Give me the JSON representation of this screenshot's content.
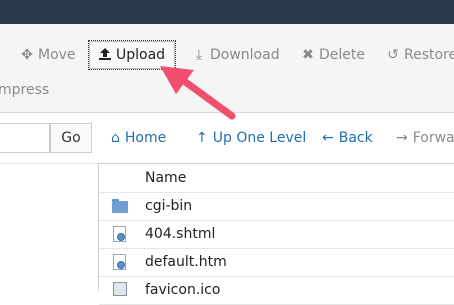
{
  "toolbar": {
    "move_label": "Move",
    "upload_label": "Upload",
    "download_label": "Download",
    "delete_label": "Delete",
    "restore_label": "Restore",
    "compress_label": "mpress"
  },
  "pathbar": {
    "go_label": "Go",
    "home_label": "Home",
    "up_label": "Up One Level",
    "back_label": "Back",
    "forward_label": "Forwar"
  },
  "filelist": {
    "header_name": "Name",
    "files": [
      {
        "name": "cgi-bin",
        "icon": "folder-icon"
      },
      {
        "name": "404.shtml",
        "icon": "html-file-icon"
      },
      {
        "name": "default.htm",
        "icon": "html-file-icon"
      },
      {
        "name": "favicon.ico",
        "icon": "image-file-icon"
      }
    ]
  },
  "colors": {
    "titlebar": "#293a4a",
    "link": "#1f6fb2",
    "arrow": "#f0506e"
  }
}
